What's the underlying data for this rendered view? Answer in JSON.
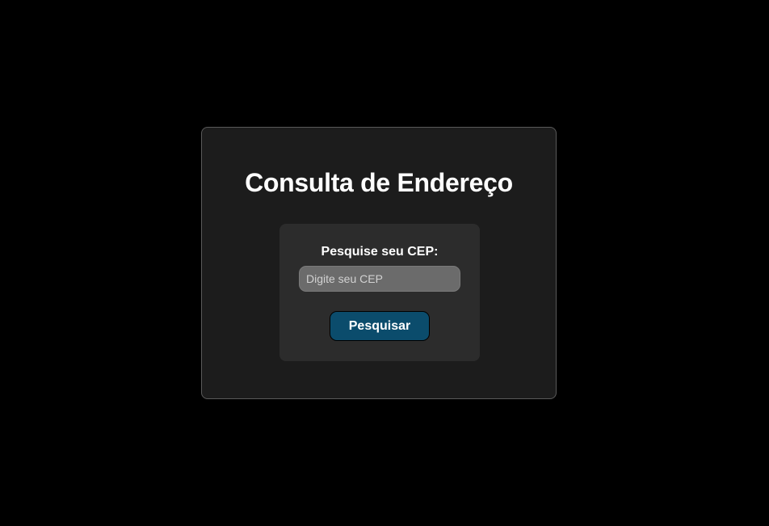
{
  "card": {
    "title": "Consulta de Endereço"
  },
  "search": {
    "label": "Pesquise seu CEP:",
    "placeholder": "Digite seu CEP",
    "value": "",
    "button_label": "Pesquisar"
  },
  "colors": {
    "background": "#000000",
    "card": "#1c1c1c",
    "panel": "#2c2c2c",
    "input": "#6b6b6b",
    "button": "#0b4c6c",
    "text": "#ffffff"
  }
}
